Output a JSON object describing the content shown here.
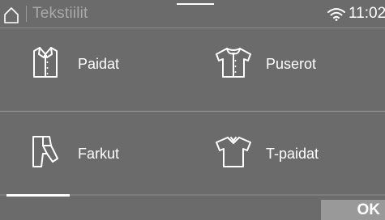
{
  "status_bar": {
    "title": "Tekstiilit",
    "time": "11:02",
    "home_icon": "home-icon",
    "wifi_icon": "wifi-icon"
  },
  "tiles": [
    {
      "label": "Paidat",
      "icon": "shirt-icon"
    },
    {
      "label": "Puserot",
      "icon": "blouse-icon"
    },
    {
      "label": "Farkut",
      "icon": "jeans-icon"
    },
    {
      "label": "T-paidat",
      "icon": "tshirt-icon"
    }
  ],
  "pagination": {
    "current_page": 1
  },
  "footer": {
    "ok_label": "OK"
  },
  "colors": {
    "background": "#6b6b6b",
    "text": "#ffffff",
    "title_text": "#aaaaaa",
    "ok_button": "#999999"
  }
}
